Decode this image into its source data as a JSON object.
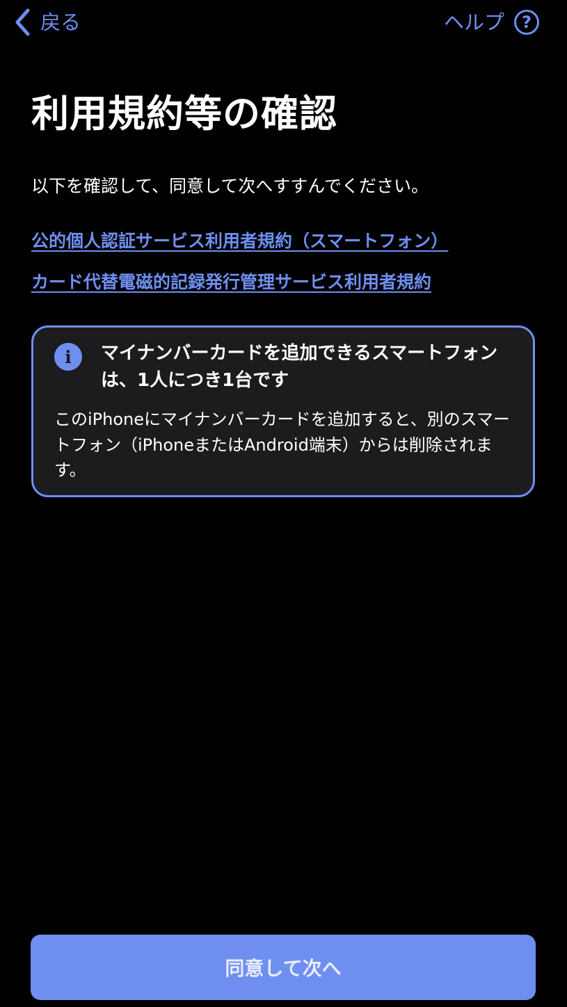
{
  "nav": {
    "back_label": "戻る",
    "help_label": "ヘルプ",
    "help_glyph": "?"
  },
  "title": "利用規約等の確認",
  "instruction": "以下を確認して、同意して次へすすんでください。",
  "links": [
    "公的個人認証サービス利用者規約（スマートフォン）",
    "カード代替電磁的記録発行管理サービス利用者規約"
  ],
  "notice": {
    "icon": "info-icon",
    "icon_glyph": "i",
    "heading": "マイナンバーカードを追加できるスマートフォンは、1人につき1台です",
    "body": "このiPhoneにマイナンバーカードを追加すると、別のスマートフォン（iPhoneまたはAndroid端末）からは削除されます。"
  },
  "button": {
    "agree_label": "同意して次へ"
  },
  "colors": {
    "accent": "#6f8ff0",
    "background": "#000000",
    "card_background": "#1c1c1e"
  }
}
